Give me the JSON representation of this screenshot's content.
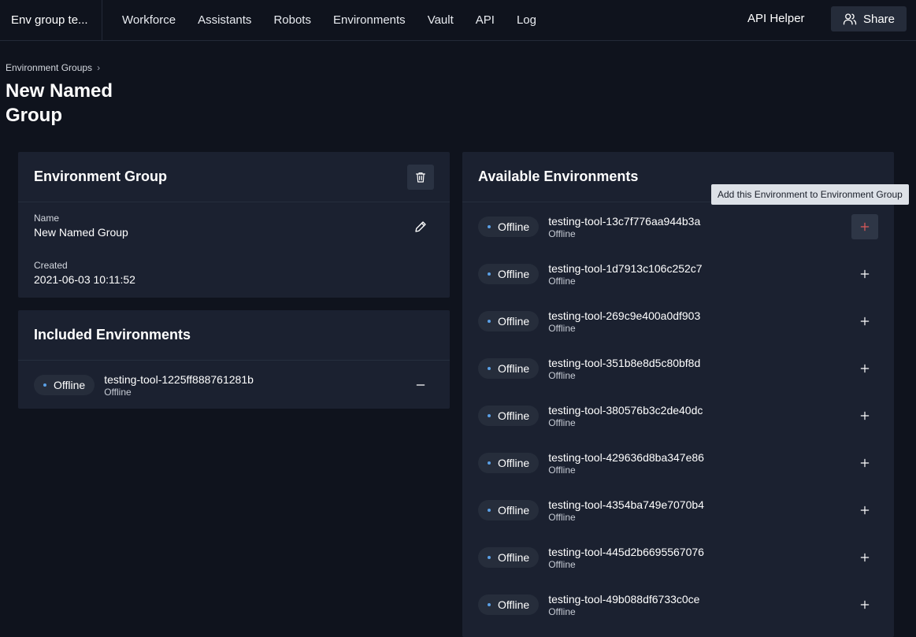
{
  "app": {
    "title": "Env group te..."
  },
  "nav": [
    {
      "label": "Workforce"
    },
    {
      "label": "Assistants"
    },
    {
      "label": "Robots"
    },
    {
      "label": "Environments"
    },
    {
      "label": "Vault"
    },
    {
      "label": "API"
    },
    {
      "label": "Log"
    }
  ],
  "header_right": {
    "api_helper": "API Helper",
    "share": "Share"
  },
  "breadcrumb": {
    "parent": "Environment Groups"
  },
  "page": {
    "title": "New Named Group"
  },
  "group_card": {
    "title": "Environment Group",
    "name_label": "Name",
    "name_value": "New Named Group",
    "created_label": "Created",
    "created_value": "2021-06-03 10:11:52"
  },
  "included": {
    "title": "Included Environments",
    "items": [
      {
        "pill": "Offline",
        "name": "testing-tool-1225ff888761281b",
        "status": "Offline"
      }
    ]
  },
  "available": {
    "title": "Available Environments",
    "tooltip": "Add this Environment to Environment Group",
    "items": [
      {
        "pill": "Offline",
        "name": "testing-tool-13c7f776aa944b3a",
        "status": "Offline"
      },
      {
        "pill": "Offline",
        "name": "testing-tool-1d7913c106c252c7",
        "status": "Offline"
      },
      {
        "pill": "Offline",
        "name": "testing-tool-269c9e400a0df903",
        "status": "Offline"
      },
      {
        "pill": "Offline",
        "name": "testing-tool-351b8e8d5c80bf8d",
        "status": "Offline"
      },
      {
        "pill": "Offline",
        "name": "testing-tool-380576b3c2de40dc",
        "status": "Offline"
      },
      {
        "pill": "Offline",
        "name": "testing-tool-429636d8ba347e86",
        "status": "Offline"
      },
      {
        "pill": "Offline",
        "name": "testing-tool-4354ba749e7070b4",
        "status": "Offline"
      },
      {
        "pill": "Offline",
        "name": "testing-tool-445d2b6695567076",
        "status": "Offline"
      },
      {
        "pill": "Offline",
        "name": "testing-tool-49b088df6733c0ce",
        "status": "Offline"
      }
    ]
  },
  "colors": {
    "background": "#0f131d",
    "card": "#1b2130",
    "status_dot": "#5aa0e6",
    "add_hover": "#e05a5a"
  }
}
